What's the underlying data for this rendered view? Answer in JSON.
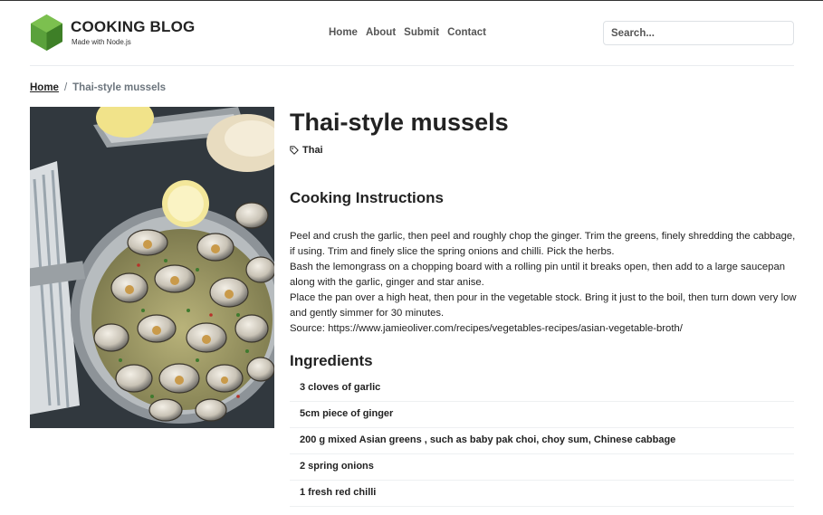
{
  "brand": {
    "title": "COOKING BLOG",
    "subtitle": "Made with Node.js",
    "logo_icon": "hexagon-logo-icon",
    "logo_color": "#5aa13b"
  },
  "nav": {
    "items": [
      "Home",
      "About",
      "Submit",
      "Contact"
    ]
  },
  "search": {
    "placeholder": "Search..."
  },
  "breadcrumb": {
    "home": "Home",
    "separator": "/",
    "current": "Thai-style mussels"
  },
  "recipe": {
    "title": "Thai-style mussels",
    "tag": "Thai",
    "tag_icon": "tag-icon",
    "instructions_heading": "Cooking Instructions",
    "instructions": [
      "Peel and crush the garlic, then peel and roughly chop the ginger. Trim the greens, finely shredding the cabbage, if using. Trim and finely slice the spring onions and chilli. Pick the herbs.",
      "Bash the lemongrass on a chopping board with a rolling pin until it breaks open, then add to a large saucepan along with the garlic, ginger and star anise.",
      "Place the pan over a high heat, then pour in the vegetable stock. Bring it just to the boil, then turn down very low and gently simmer for 30 minutes.",
      "Source: https://www.jamieoliver.com/recipes/vegetables-recipes/asian-vegetable-broth/"
    ],
    "ingredients_heading": "Ingredients",
    "ingredients": [
      "3 cloves of garlic",
      "5cm piece of ginger",
      "200 g mixed Asian greens , such as baby pak choi, choy sum, Chinese cabbage",
      "2 spring onions",
      "1 fresh red chilli"
    ]
  }
}
